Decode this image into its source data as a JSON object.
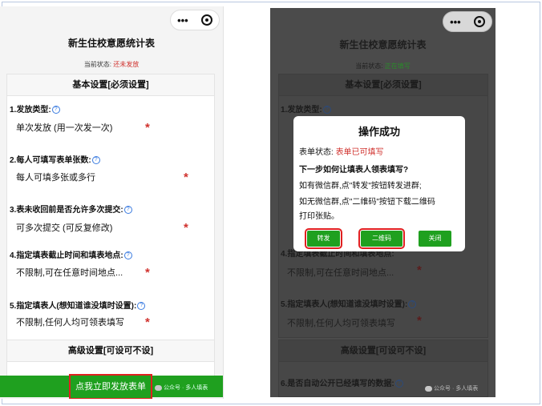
{
  "left": {
    "title": "新生住校意愿统计表",
    "status_label": "当前状态:",
    "status_value": "还未发放",
    "basic_header": "基本设置[必须设置]",
    "questions": [
      {
        "label": "1.发放类型:",
        "value": "单次发放 (用一次发一次)"
      },
      {
        "label": "2.每人可填写表单张数:",
        "value": "每人可填多张或多行"
      },
      {
        "label": "3.表未收回前是否允许多次提交:",
        "value": "可多次提交 (可反复修改)"
      },
      {
        "label": "4.指定填表截止时间和填表地点:",
        "value": "不限制,可在任意时间地点..."
      },
      {
        "label": "5.指定填表人(想知道谁没填时设置):",
        "value": "不限制,任何人均可领表填写"
      }
    ],
    "advanced_header": "高级设置[可设可不设]",
    "publish_button": "点我立即发放表单",
    "watermark": "公众号 · 多人填表"
  },
  "right": {
    "title": "新生住校意愿统计表",
    "status_label": "当前状态:",
    "status_value": "正在填写",
    "basic_header": "基本设置[必须设置]",
    "q1": "1.发放类型:",
    "q4": "4.指定填表截止时间和填表地点:",
    "q4_value": "不限制,可在任意时间地点...",
    "q5": "5.指定填表人(想知道谁没填时设置):",
    "q5_value": "不限制,任何人均可领表填写",
    "advanced_header": "高级设置[可设可不设]",
    "q6": "6.是否自动公开已经填写的数据:",
    "watermark": "公众号 · 多人填表",
    "modal": {
      "title": "操作成功",
      "status_label": "表单状态:",
      "status_value": "表单已可填写",
      "question": "下一步如何让填表人领表填写?",
      "line1": "如有微信群,点\"转发\"按钮转发进群;",
      "line2": "如无微信群,点\"二维码\"按钮下载二维码",
      "line3": "打印张贴。",
      "btn_forward": "转发",
      "btn_qrcode": "二维码",
      "btn_close": "关闭"
    }
  },
  "help_glyph": "?",
  "required_mark": "*",
  "capsule_more": "•••",
  "colors": {
    "accent_green": "#1fa01f",
    "required_red": "#d0322e",
    "highlight_red": "#e02020",
    "help_blue": "#3a7be0"
  }
}
